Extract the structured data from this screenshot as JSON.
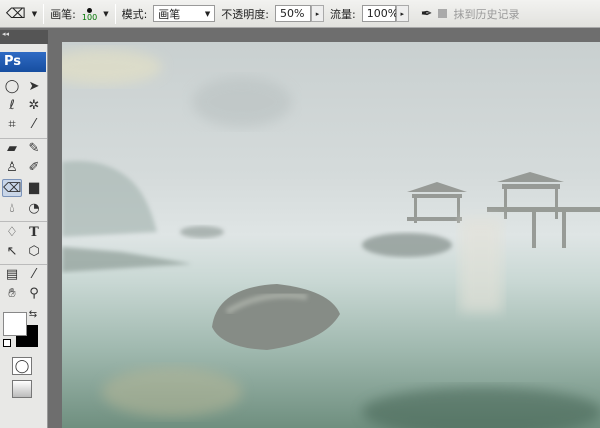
{
  "options_bar": {
    "tool_icon": "eraser-icon",
    "brush_label": "画笔:",
    "brush_size": "100",
    "mode_label": "模式:",
    "mode_value": "画笔",
    "opacity_label": "不透明度:",
    "opacity_value": "50%",
    "flow_label": "流量:",
    "flow_value": "100%",
    "airbrush_icon": "airbrush-icon",
    "erase_to_history_label": "抹到历史记录"
  },
  "toolbox": {
    "logo": "Ps",
    "header": "◂◂"
  },
  "colors": {
    "foreground": "#ffffff",
    "background": "#000000"
  }
}
